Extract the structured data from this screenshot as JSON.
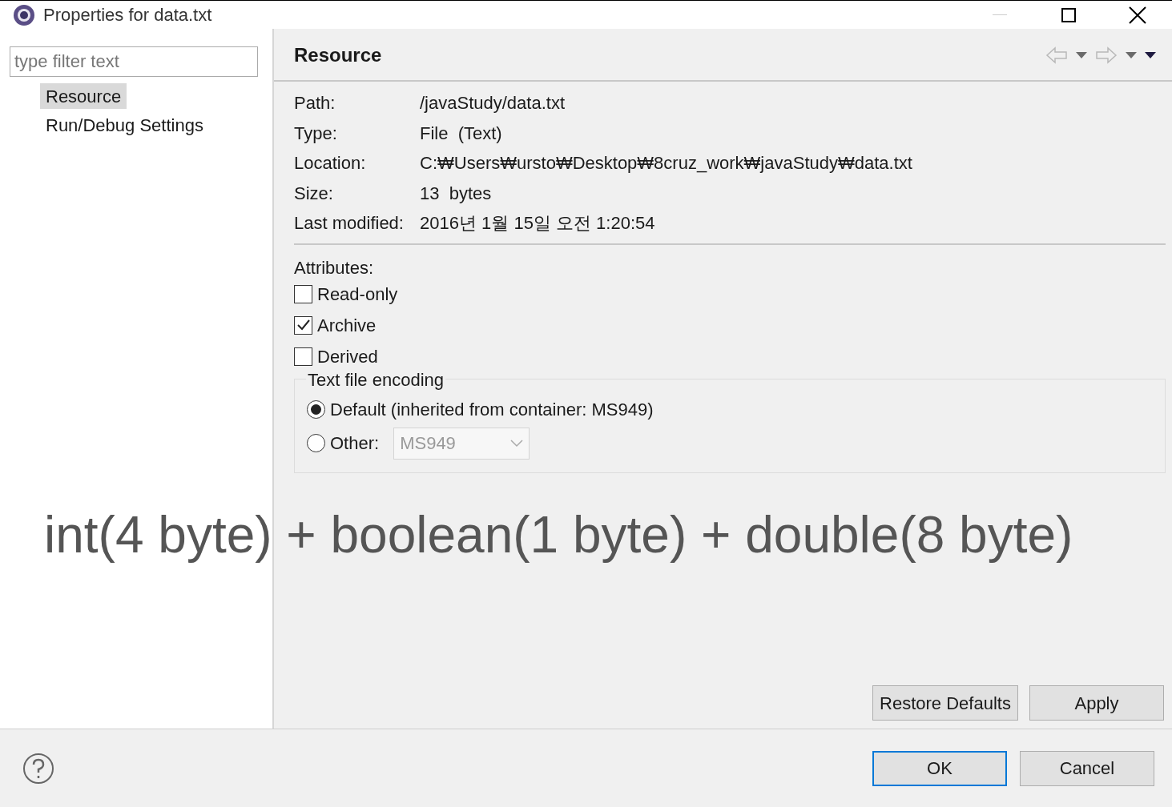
{
  "window": {
    "title": "Properties for data.txt"
  },
  "sidebar": {
    "filter": {
      "placeholder": "type filter text"
    },
    "items": [
      {
        "label": "Resource",
        "selected": true
      },
      {
        "label": "Run/Debug Settings",
        "selected": false
      }
    ]
  },
  "page": {
    "title": "Resource",
    "info": [
      {
        "label": "Path:",
        "value": "/javaStudy/data.txt"
      },
      {
        "label": "Type:",
        "value": "File  (Text)"
      },
      {
        "label": "Location:",
        "value": "C:₩Users₩ursto₩Desktop₩8cruz_work₩javaStudy₩data.txt"
      },
      {
        "label": "Size:",
        "value": "13  bytes"
      },
      {
        "label": "Last modified:",
        "value": "2016년 1월 15일 오전 1:20:54"
      }
    ],
    "attributes_label": "Attributes:",
    "attributes": [
      {
        "label": "Read-only",
        "checked": false
      },
      {
        "label": "Archive",
        "checked": true
      },
      {
        "label": "Derived",
        "checked": false
      }
    ],
    "encoding": {
      "title": "Text file encoding",
      "options": [
        {
          "label": "Default (inherited from container: MS949)",
          "selected": true
        },
        {
          "label": "Other:",
          "selected": false
        }
      ],
      "other_value": "MS949",
      "other_disabled": true
    },
    "buttons": [
      "Restore Defaults",
      "Apply"
    ]
  },
  "caption": "int(4 byte) + boolean(1 byte) + double(8 byte)",
  "footer": {
    "buttons": [
      {
        "label": "OK",
        "default": true
      },
      {
        "label": "Cancel",
        "default": false
      }
    ]
  }
}
